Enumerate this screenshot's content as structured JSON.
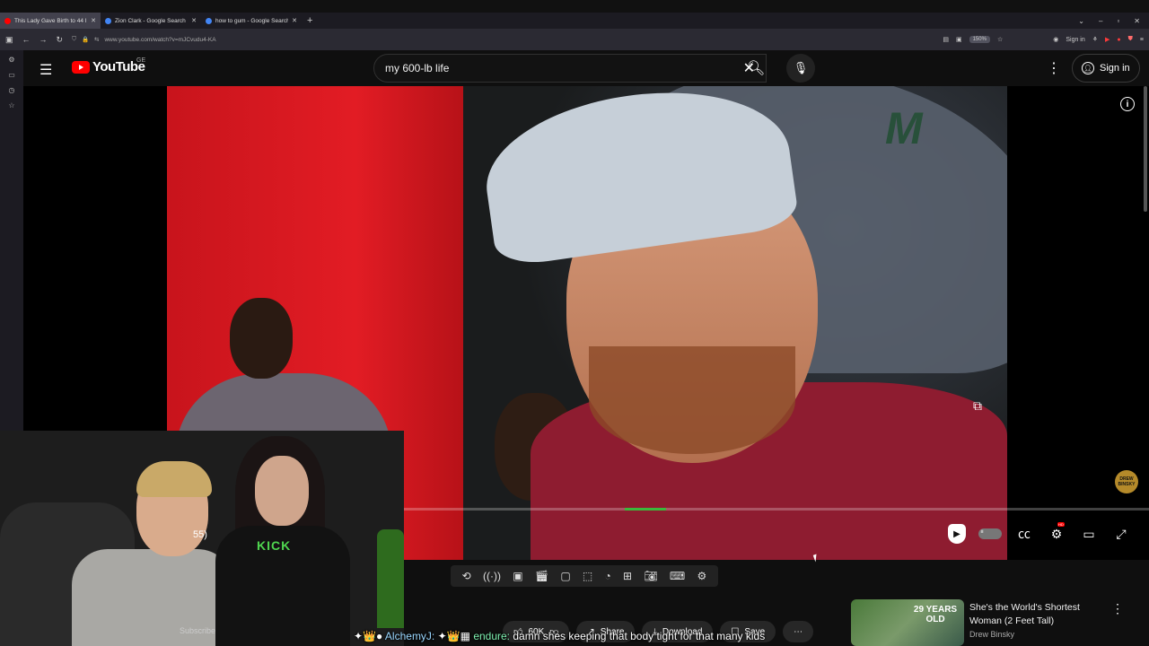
{
  "browser": {
    "tabs": [
      {
        "title": "This Lady Gave Birth to 44 I",
        "favicon_color": "#ff0000",
        "active": true
      },
      {
        "title": "Zion Clark - Google Search",
        "favicon_color": "#4285f4",
        "active": false
      },
      {
        "title": "how to gum - Google Search",
        "favicon_color": "#4285f4",
        "active": false
      }
    ],
    "new_tab": "+",
    "url": "www.youtube.com/watch?v=mJCvudu4-KA",
    "zoom": "150%",
    "signin_label": "Sign in"
  },
  "youtube": {
    "logo_word": "YouTube",
    "region": "GE",
    "search_value": "my 600-lb life",
    "signin_label": "Sign in"
  },
  "player": {
    "time_partial": "55)",
    "video_logo": "M",
    "channel_badge": "DREW BINSKY",
    "progress_played": 0.014
  },
  "webcam": {
    "shirt_text": "KICK",
    "subscribe_text": "Subscribe"
  },
  "actions": {
    "like_count": "60K",
    "share": "Share",
    "download": "Download",
    "save": "Save"
  },
  "recommended": {
    "thumb_text": "29 YEARS OLD",
    "title": "She's the World's Shortest Woman (2 Feet Tall)",
    "channel": "Drew Binsky"
  },
  "chat": {
    "user1": "AlchemyJ:",
    "user2": "endure:",
    "message": "damn shes keeping that body tight for that many kids"
  },
  "colors": {
    "accent": "#ff0000",
    "background": "#0f0f0f",
    "buffer": "#3bb83b"
  }
}
